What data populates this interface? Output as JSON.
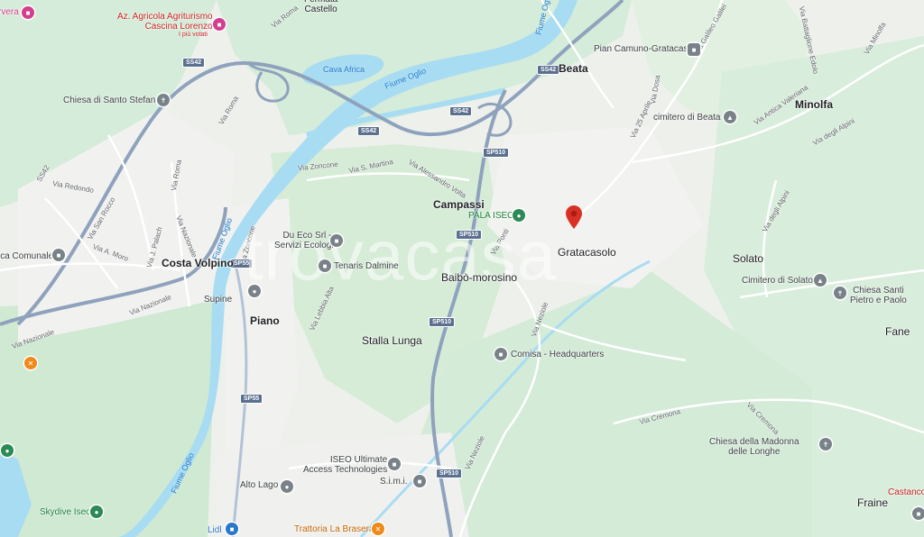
{
  "watermark": "trovacasa",
  "places": [
    {
      "id": "castello",
      "text": "Fermata\nCastello"
    },
    {
      "id": "beata",
      "text": "Beata"
    },
    {
      "id": "minolfa",
      "text": "Minolfa"
    },
    {
      "id": "campassi",
      "text": "Campassi"
    },
    {
      "id": "gratacasolo",
      "text": "Gratacasolo"
    },
    {
      "id": "costa-volpino",
      "text": "Costa Volpino"
    },
    {
      "id": "baibo",
      "text": "Baibò-morosino"
    },
    {
      "id": "piano",
      "text": "Piano"
    },
    {
      "id": "stalla-lunga",
      "text": "Stalla Lunga"
    },
    {
      "id": "solato",
      "text": "Solato"
    },
    {
      "id": "fane",
      "text": "Fane"
    },
    {
      "id": "fraine",
      "text": "Fraine"
    },
    {
      "id": "alto-lago",
      "text": "Alto Lago"
    },
    {
      "id": "supine",
      "text": "Supine"
    }
  ],
  "pois": {
    "agriturismo": "Az. Agricola Agriturismo\nCascina Lorenzo",
    "agriturismo_sub": "I più votati",
    "chiesa_santo_stefano": "Chiesa di Santo Stefano",
    "pian_camuno": "Pian Camuno-Gratacasolo",
    "cimitero_beata": "cimitero di Beata",
    "pala_iseo": "PALA ISEO",
    "du_eco": "Du Eco Srl -\nServizi Ecologici",
    "tenaris": "Tenaris Dalmine",
    "comisa": "Comisa - Headquarters",
    "cimitero_solato": "Cimitero di Solato",
    "chiesa_santi": "Chiesa Santi\nPietro e Paolo",
    "chiesa_madonna": "Chiesa della Madonna\ndelle Longhe",
    "iseo_ultimate": "ISEO Ultimate\nAccess Technologies",
    "simi": "S.i.m.i.",
    "skydive": "Skydive Iseo",
    "trattoria": "Trattoria La Brasera",
    "lidl": "Lidl",
    "castanco": "Castanco",
    "comunale": "ica Comunale",
    "top_left": "rvera"
  },
  "water": {
    "cava_africa": "Cava Africa",
    "fiume_oglio_1": "Fiume Oglio",
    "fiume_oglio_2": "Fiume Oglio",
    "fiume_oglio_3": "Fiume Oglio",
    "fiume_oglio_4": "Fiume Oglio"
  },
  "streets": {
    "via_roma_1": "Via Roma",
    "via_roma_2": "Via Roma",
    "via_roma_3": "Via Roma",
    "ss42": "SS42",
    "via_redondo": "Via Redondo",
    "via_san_rocco": "Via San Rocco",
    "via_palach": "Via J. Palach",
    "via_moro": "Via A. Moro",
    "via_nazionale_1": "Via Nazionale",
    "via_nazionale_2": "Via Nazionale",
    "via_nazionale_3": "Via Nazionale",
    "via_zoncone_1": "Via Zoncone",
    "via_zoncone_2": "Via Zoncone",
    "via_s_martina": "Via S. Martina",
    "via_volta": "Via Alessandro Volta",
    "via_ponti": "Via Ponti",
    "via_dosa": "Via Dosa",
    "via_25_aprile": "Via 25 Aprile",
    "via_galileo": "Via Galileo Galilei",
    "via_battaglione": "Via Battaglione Edolo",
    "via_minolfa": "Via Minolfa",
    "via_antica": "Via Antica Valeriana",
    "via_alpini_1": "Via degli Alpini",
    "via_alpini_2": "Via degli Alpini",
    "via_lebbia": "Via Lebbia Alta",
    "via_neziole_1": "Via Neziole",
    "via_neziole_2": "Via Neziole",
    "via_cremona_1": "Via Cremona",
    "via_cremona_2": "Via Cremona"
  },
  "shields": [
    "SS42",
    "SS42",
    "SS42",
    "SS42",
    "SP510",
    "SP510",
    "SP510",
    "SP510",
    "SP55",
    "SP55"
  ]
}
